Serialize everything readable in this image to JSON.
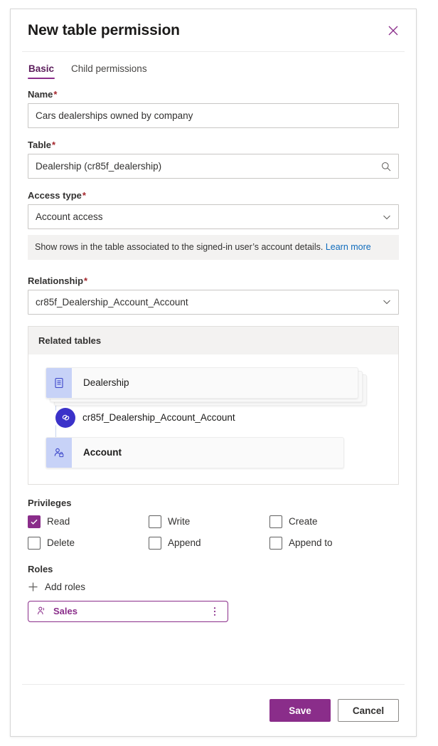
{
  "dialog": {
    "title": "New table permission",
    "close_icon": "close-icon"
  },
  "tabs": [
    {
      "label": "Basic",
      "active": true
    },
    {
      "label": "Child permissions",
      "active": false
    }
  ],
  "fields": {
    "name": {
      "label": "Name",
      "required": "*",
      "value": "Cars dealerships owned by company"
    },
    "table": {
      "label": "Table",
      "required": "*",
      "value": "Dealership (cr85f_dealership)",
      "icon": "search-icon"
    },
    "access_type": {
      "label": "Access type",
      "required": "*",
      "value": "Account access",
      "icon": "chevron-down-icon",
      "hint": "Show rows in the table associated to the signed-in user’s account details.",
      "hint_link": "Learn more"
    },
    "relationship": {
      "label": "Relationship",
      "required": "*",
      "value": "cr85f_Dealership_Account_Account",
      "icon": "chevron-down-icon"
    }
  },
  "related_tables": {
    "panel_title": "Related tables",
    "source_table": "Dealership",
    "source_icon": "table-icon",
    "relationship_name": "cr85f_Dealership_Account_Account",
    "relationship_icon": "link-icon",
    "target_table": "Account",
    "target_icon": "account-icon"
  },
  "privileges": {
    "label": "Privileges",
    "items": [
      {
        "label": "Read",
        "checked": true
      },
      {
        "label": "Write",
        "checked": false
      },
      {
        "label": "Create",
        "checked": false
      },
      {
        "label": "Delete",
        "checked": false
      },
      {
        "label": "Append",
        "checked": false
      },
      {
        "label": "Append to",
        "checked": false
      }
    ]
  },
  "roles": {
    "label": "Roles",
    "add_label": "Add roles",
    "add_icon": "plus-icon",
    "chips": [
      {
        "label": "Sales",
        "icon": "person-icon",
        "more_icon": "more-vertical-icon"
      }
    ]
  },
  "footer": {
    "save_label": "Save",
    "cancel_label": "Cancel"
  },
  "colors": {
    "accent": "#8a2d8a",
    "required": "#a4262c",
    "link": "#0f6cbd",
    "badge": "#3b32c9",
    "card_icon_bg": "#c7d2f7"
  }
}
